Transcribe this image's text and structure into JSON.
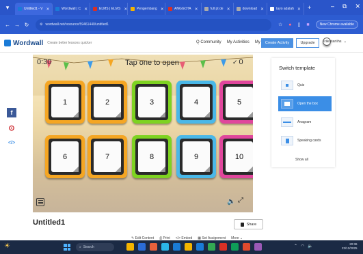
{
  "browser": {
    "tabs": [
      {
        "label": "Untitled1 - V",
        "active": true,
        "color": "#1a7bd7"
      },
      {
        "label": "Wordwall | C",
        "active": false,
        "color": "#1a7bd7"
      },
      {
        "label": "ELMS | ELMS",
        "active": false,
        "color": "#d93025"
      },
      {
        "label": "Pengembang",
        "active": false,
        "color": "#f4b400"
      },
      {
        "label": "ANGGOTA",
        "active": false,
        "color": "#d93025"
      },
      {
        "label": "full pt de",
        "active": false,
        "color": "#aaaaaa"
      },
      {
        "label": "download",
        "active": false,
        "color": "#aaaaaa"
      },
      {
        "label": "tayo adalah",
        "active": false,
        "color": "#ffffff"
      }
    ],
    "new_tab_glyph": "+",
    "address": "wordwall.net/resource/59461440/untitled1",
    "update_button": "New Chrome available"
  },
  "site": {
    "logo": "Wordwall",
    "tagline": "Create better lessons quicker",
    "nav": [
      "Community",
      "My Activities",
      "My Results"
    ],
    "create_button": "Create Activity",
    "upgrade_button": "Upgrade",
    "user": "srilestariihs"
  },
  "game": {
    "timer": "0:30",
    "prompt": "Tap one to open",
    "score": "0",
    "boxes": [
      {
        "label": "1",
        "color": "#f5a623"
      },
      {
        "label": "2",
        "color": "#f5a623"
      },
      {
        "label": "3",
        "color": "#7ed321"
      },
      {
        "label": "4",
        "color": "#4ab8e8"
      },
      {
        "label": "5",
        "color": "#e0469c"
      },
      {
        "label": "6",
        "color": "#f5a623"
      },
      {
        "label": "7",
        "color": "#f5a623"
      },
      {
        "label": "8",
        "color": "#7ed321"
      },
      {
        "label": "9",
        "color": "#4ab8e8"
      },
      {
        "label": "10",
        "color": "#e0469c"
      }
    ]
  },
  "switch_template": {
    "title": "Switch template",
    "items": [
      {
        "label": "Quiz",
        "selected": false
      },
      {
        "label": "Open the box",
        "selected": true
      },
      {
        "label": "Anagram",
        "selected": false
      },
      {
        "label": "Speaking cards",
        "selected": false
      }
    ],
    "show_all": "Show all"
  },
  "activity": {
    "title": "Untitled1",
    "share_button": "Share",
    "actions": [
      "Edit Content",
      "Print",
      "Embed",
      "Set Assignment",
      "More"
    ]
  },
  "taskbar": {
    "search_placeholder": "Search",
    "app_colors": [
      "#f4b400",
      "#2b6cd8",
      "#e8613c",
      "#2bb5e8",
      "#1a7bd7",
      "#f4b400",
      "#1a7bd7",
      "#33a853",
      "#d93025",
      "#0f9d58",
      "#e04a2e",
      "#9b59b6"
    ],
    "clock_time": "20:36",
    "clock_date": "22/12/2025"
  },
  "colors": {
    "browser_bg": "#2a55c9",
    "accent": "#4a90e2",
    "taskbar_bg": "#1b2a44"
  }
}
